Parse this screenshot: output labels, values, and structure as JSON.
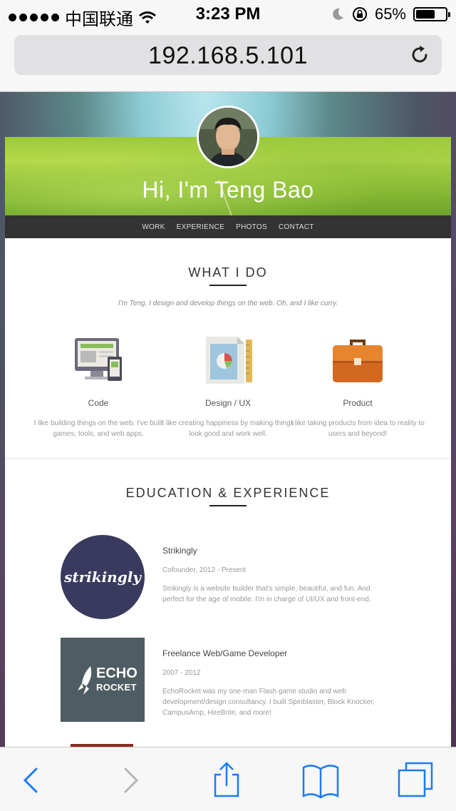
{
  "status": {
    "carrier": "中国联通",
    "time": "3:23 PM",
    "battery_percent": "65%",
    "battery_level": 0.65
  },
  "browser": {
    "url": "192.168.5.101"
  },
  "site": {
    "hero_title": "Hi, I'm Teng Bao",
    "nav": [
      "WORK",
      "EXPERIENCE",
      "PHOTOS",
      "CONTACT"
    ],
    "what_i_do": {
      "title": "WHAT I DO",
      "tagline": "I'm Teng. I design and develop things on the web. Oh, and I like curry.",
      "features": [
        {
          "name": "Code",
          "desc": "I like building things on the web. I've built games, tools, and web apps.",
          "icon": "monitor-icon"
        },
        {
          "name": "Design / UX",
          "desc": "I like creating happiness by making things look good and work well.",
          "icon": "design-icon"
        },
        {
          "name": "Product",
          "desc": "I like taking products from idea to reality to users and beyond!",
          "icon": "briefcase-icon"
        }
      ]
    },
    "education": {
      "title": "EDUCATION & EXPERIENCE",
      "items": [
        {
          "logo_text": "strikingly",
          "title": "Strikingly",
          "meta": "Cofounder, 2012 - Present",
          "desc": "Strikingly is a website builder that's simple, beautiful, and fun. And perfect for the age of mobile. I'm in charge of UI/UX and front-end."
        },
        {
          "logo_text": "ECHO",
          "logo_sub": "ROCKET",
          "title": "Freelance Web/Game Developer",
          "meta": "2007 - 2012",
          "desc": "EchoRocket was my one-man Flash game studio and web development/design consultancy. I built Spinblaster, Block Knocker, CampusAmp, HireBrite, and more!"
        }
      ]
    }
  },
  "colors": {
    "nav_bg": "#333333",
    "ios_blue": "#1a7cf5",
    "strikingly_bg": "#3a3a5e",
    "echo_bg": "#4e5d63"
  }
}
